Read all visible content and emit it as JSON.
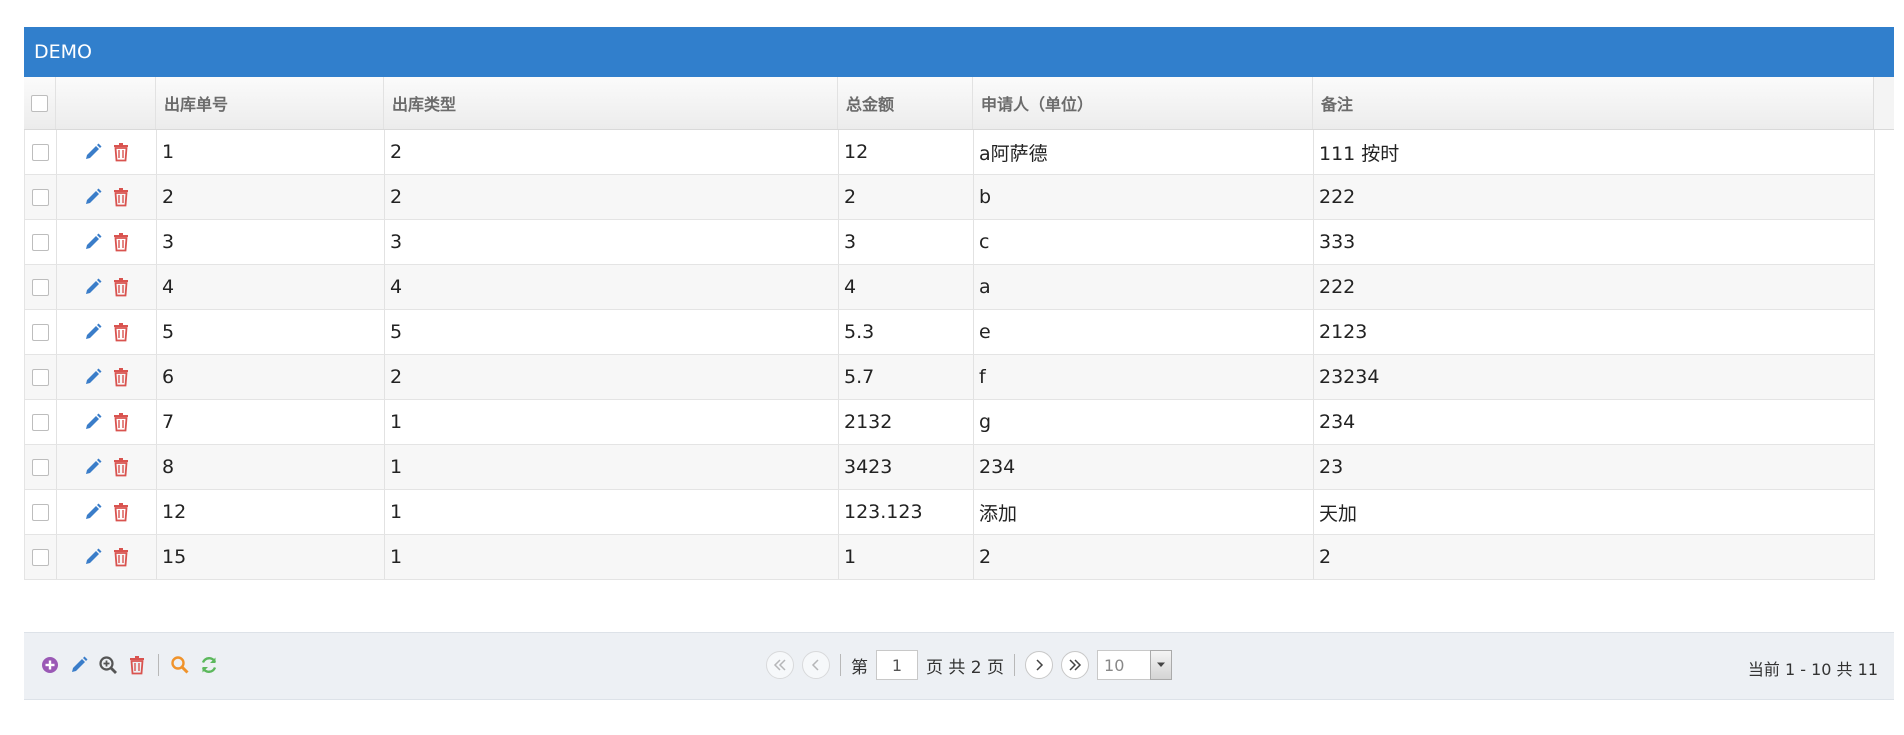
{
  "grid": {
    "title": "DEMO",
    "columns": [
      "出库单号",
      "出库类型",
      "总金额",
      "申请人（单位）",
      "备注"
    ],
    "rows": [
      [
        "1",
        "2",
        "12",
        "a阿萨德",
        "111 按时"
      ],
      [
        "2",
        "2",
        "2",
        "b",
        "222"
      ],
      [
        "3",
        "3",
        "3",
        "c",
        "333"
      ],
      [
        "4",
        "4",
        "4",
        "a",
        "222"
      ],
      [
        "5",
        "5",
        "5.3",
        "e",
        "2123"
      ],
      [
        "6",
        "2",
        "5.7",
        "f",
        "23234"
      ],
      [
        "7",
        "1",
        "2132",
        "g",
        "234"
      ],
      [
        "8",
        "1",
        "3423",
        "234",
        "23"
      ],
      [
        "12",
        "1",
        "123.123",
        "添加",
        "天加"
      ],
      [
        "15",
        "1",
        "1",
        "2",
        "2"
      ]
    ]
  },
  "pager": {
    "tools": [
      "add-icon",
      "edit-icon",
      "view-icon",
      "delete-icon",
      "search-icon",
      "refresh-icon"
    ],
    "page_prefix": "第",
    "page_value": "1",
    "page_suffix": "页 共 2 页",
    "page_size": "10",
    "info": "当前 1 - 10 共 11"
  },
  "colors": {
    "title_bg": "#317fcc",
    "edit_icon": "#3a7dc9",
    "delete_icon": "#d9534f",
    "add_icon": "#9a59b5",
    "search_icon": "#f0932b",
    "refresh_icon": "#5cb85c"
  }
}
